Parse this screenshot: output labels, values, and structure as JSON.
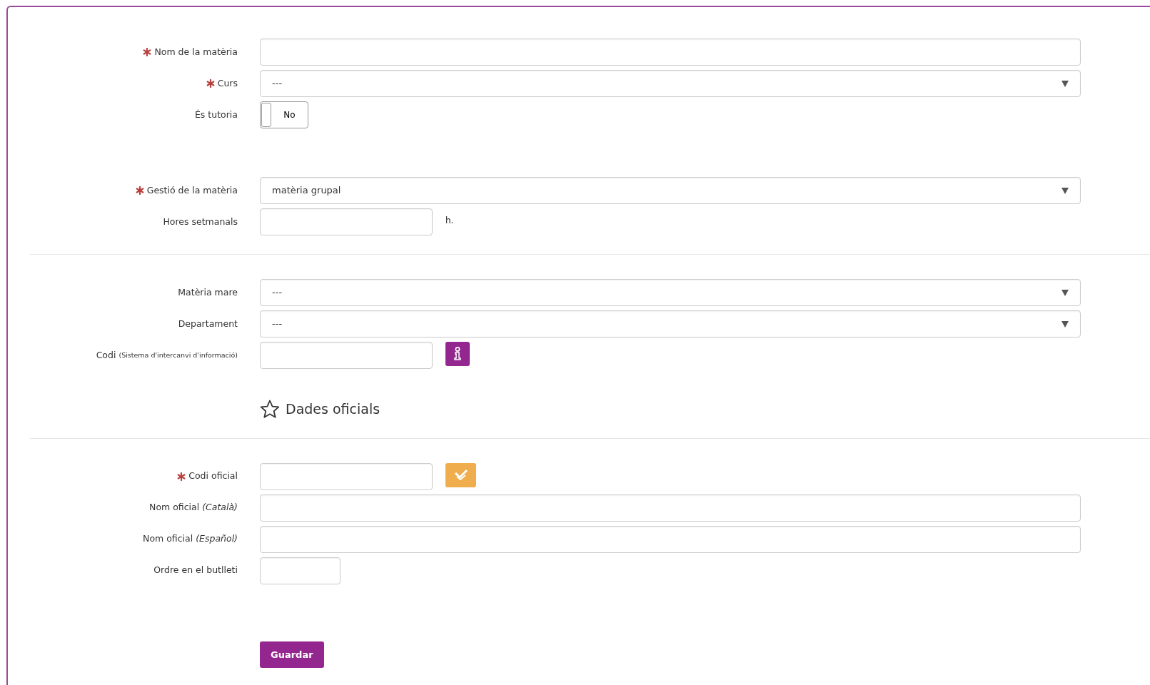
{
  "groups": [
    {
      "divider_after": false,
      "fields": [
        {
          "kind": "text",
          "label": "Nom de la matèria",
          "required": true
        },
        {
          "kind": "select",
          "label": "Curs",
          "required": true,
          "value": "---"
        },
        {
          "kind": "toggle",
          "label": "És tutoria",
          "required": false,
          "value": "No",
          "on": false
        }
      ]
    },
    {
      "divider_after": true,
      "fields": [
        {
          "kind": "select",
          "label": "Gestió de la matèria",
          "required": true,
          "value": "matèria grupal"
        },
        {
          "kind": "short",
          "label": "Hores setmanals",
          "required": false,
          "unit": "h."
        }
      ]
    },
    {
      "divider_after": true,
      "heading": "Dades oficials",
      "fields": [
        {
          "kind": "select",
          "label": "Matèria mare",
          "required": false,
          "value": "---"
        },
        {
          "kind": "select",
          "label": "Departament",
          "required": false,
          "value": "---"
        },
        {
          "kind": "short",
          "label": "Codi",
          "note": "(Sistema d'intercanvi d'informació)",
          "required": false,
          "button": {
            "kind": "info"
          }
        }
      ]
    },
    {
      "divider_after": false,
      "fields": [
        {
          "kind": "short",
          "label": "Codi oficial",
          "required": true,
          "button": {
            "kind": "check"
          }
        },
        {
          "kind": "text",
          "label": "Nom oficial *(Català)*",
          "required": false
        },
        {
          "kind": "text",
          "label": "Nom oficial *(Español)*",
          "required": false
        },
        {
          "kind": "tiny",
          "label": "Ordre en el butlleti",
          "required": false
        }
      ]
    }
  ],
  "submit": "Guardar"
}
